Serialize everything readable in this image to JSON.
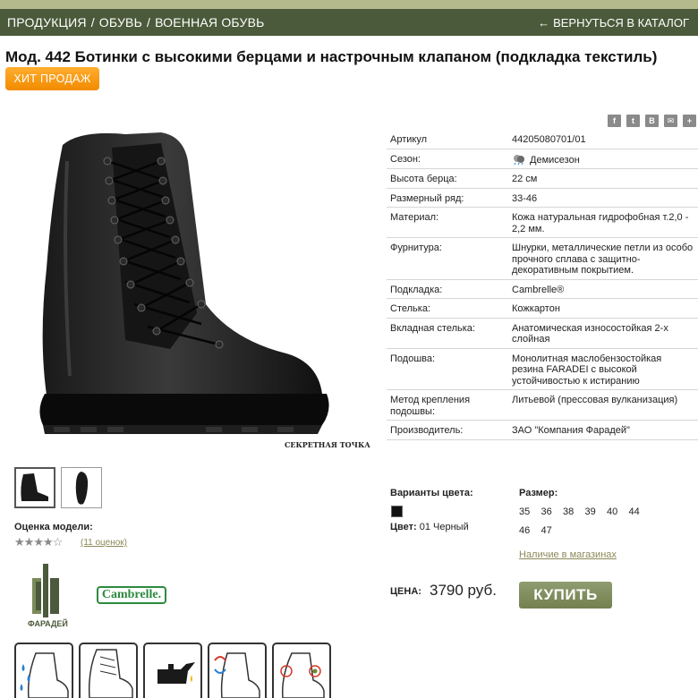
{
  "nav": {
    "breadcrumb": [
      "ПРОДУКЦИЯ",
      "ОБУВЬ",
      "ВОЕННАЯ ОБУВЬ"
    ],
    "separator": "/",
    "back_arrow": "←",
    "back_label": "ВЕРНУТЬСЯ В КАТАЛОГ"
  },
  "product": {
    "title": "Мод. 442 Ботинки с высокими берцами и настрочным клапаном (подкладка текстиль)",
    "badge": "ХИТ ПРОДАЖ",
    "watermark": "СЕКРЕТНАЯ ТОЧКА"
  },
  "share": [
    "f",
    "t",
    "В",
    "✉",
    "+"
  ],
  "specs": [
    {
      "k": "Артикул",
      "v": "44205080701/01"
    },
    {
      "k": "Сезон:",
      "v": "Демисезон",
      "icon": "weather-icon"
    },
    {
      "k": "Высота берца:",
      "v": "22 см"
    },
    {
      "k": "Размерный ряд:",
      "v": "33-46"
    },
    {
      "k": "Материал:",
      "v": "Кожа натуральная гидрофобная т.2,0 - 2,2 мм."
    },
    {
      "k": "Фурнитура:",
      "v": "Шнурки, металлические петли из особо прочного сплава с защитно-декоративным покрытием."
    },
    {
      "k": "Подкладка:",
      "v": "Cambrelle®"
    },
    {
      "k": "Стелька:",
      "v": "Кожкартон"
    },
    {
      "k": "Вкладная стелька:",
      "v": "Анатомическая износостойкая 2-х слойная"
    },
    {
      "k": "Подошва:",
      "v": "Монолитная маслобензостойкая резина FARADEI с высокой устойчивостью к истиранию"
    },
    {
      "k": "Метод крепления подошвы:",
      "v": "Литьевой (прессовая вулканизация)"
    },
    {
      "k": "Производитель:",
      "v": "ЗАО \"Компания Фарадей\""
    }
  ],
  "rating": {
    "label": "Оценка модели:",
    "stars_filled": 4,
    "stars_total": 5,
    "reviews": "(11 оценок)"
  },
  "brands": {
    "faradei": "ФАРАДЕЙ",
    "cambrelle": "Cambrelle."
  },
  "colors": {
    "label": "Варианты цвета:",
    "swatch": "#111111",
    "current_label": "Цвет:",
    "current_value": "01 Черный"
  },
  "sizes": {
    "label": "Размер:",
    "values": [
      "35",
      "36",
      "38",
      "39",
      "40",
      "44",
      "46",
      "47"
    ]
  },
  "instore": "Наличие в магазинах",
  "price": {
    "label": "ЦЕНА:",
    "value": "3790 руб."
  },
  "buy_label": "КУПИТЬ",
  "theme": {
    "nav_bg": "#4a5a3a",
    "accent_orange": "#f28b00",
    "buy_green": "#74804f"
  }
}
